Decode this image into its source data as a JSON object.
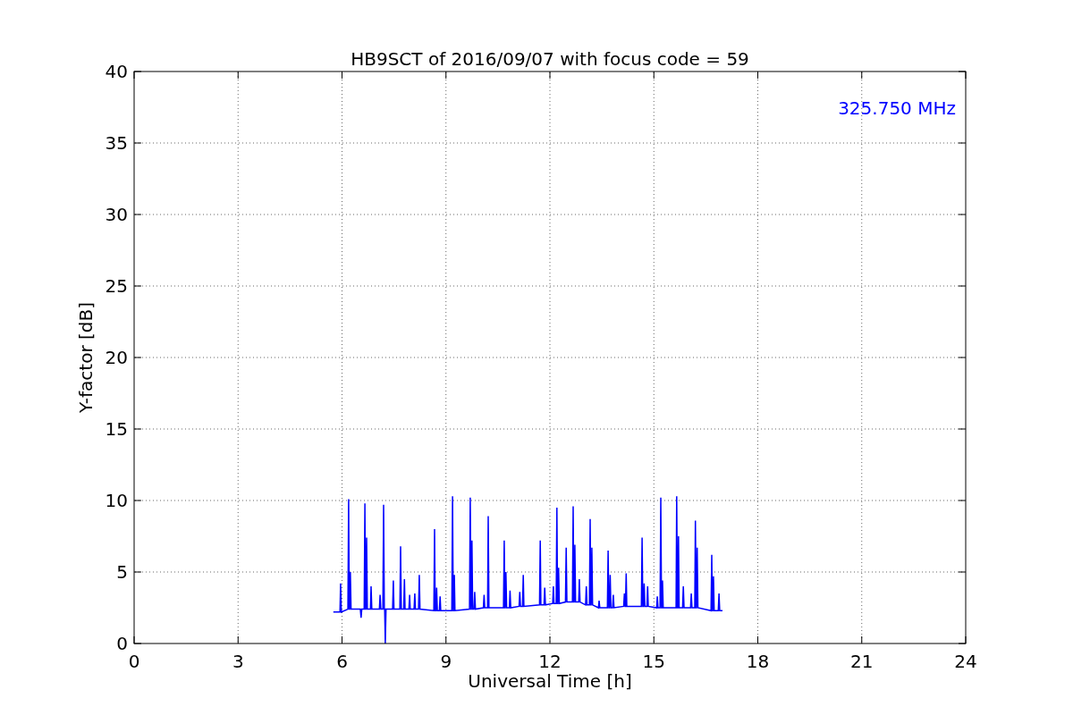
{
  "figure": {
    "chart_data": {
      "type": "line",
      "title": "HB9SCT of 2016/09/07 with focus code = 59",
      "xlabel": "Universal Time [h]",
      "ylabel": "Y-factor [dB]",
      "xlim": [
        0,
        24
      ],
      "ylim": [
        0,
        40
      ],
      "xticks": [
        0,
        3,
        6,
        9,
        12,
        15,
        18,
        21,
        24
      ],
      "yticks": [
        0,
        5,
        10,
        15,
        20,
        25,
        30,
        35,
        40
      ],
      "grid": true,
      "annotations": [
        "325.750 MHz"
      ],
      "series": [
        {
          "color": "#0000ff",
          "x": [
            5.75,
            5.94,
            5.96,
            5.98,
            6.17,
            6.19,
            6.21,
            6.22,
            6.24,
            6.26,
            6.53,
            6.55,
            6.57,
            6.64,
            6.66,
            6.68,
            6.69,
            6.71,
            6.73,
            6.82,
            6.84,
            6.86,
            7.08,
            7.1,
            7.12,
            7.18,
            7.2,
            7.22,
            7.23,
            7.25,
            7.27,
            7.46,
            7.48,
            7.5,
            7.67,
            7.69,
            7.71,
            7.78,
            7.8,
            7.82,
            7.93,
            7.95,
            7.97,
            8.08,
            8.1,
            8.12,
            8.21,
            8.23,
            8.25,
            8.65,
            8.67,
            8.69,
            8.71,
            8.73,
            8.75,
            8.81,
            8.83,
            8.85,
            9.17,
            9.19,
            9.21,
            9.22,
            9.24,
            9.26,
            9.68,
            9.7,
            9.72,
            9.73,
            9.75,
            9.77,
            9.81,
            9.83,
            9.85,
            10.08,
            10.1,
            10.12,
            10.2,
            10.22,
            10.24,
            10.66,
            10.68,
            10.7,
            10.71,
            10.73,
            10.75,
            10.83,
            10.85,
            10.87,
            11.11,
            11.13,
            11.15,
            11.21,
            11.23,
            11.25,
            11.7,
            11.72,
            11.74,
            11.83,
            11.85,
            11.87,
            12.08,
            12.1,
            12.12,
            12.18,
            12.2,
            12.22,
            12.23,
            12.25,
            12.27,
            12.45,
            12.47,
            12.49,
            12.65,
            12.67,
            12.69,
            12.7,
            12.72,
            12.74,
            12.83,
            12.85,
            12.87,
            13.03,
            13.05,
            13.07,
            13.14,
            13.16,
            13.18,
            13.19,
            13.21,
            13.23,
            13.4,
            13.42,
            13.44,
            13.66,
            13.68,
            13.7,
            13.72,
            13.74,
            13.76,
            13.81,
            13.83,
            13.85,
            14.13,
            14.15,
            14.17,
            14.18,
            14.2,
            14.22,
            14.64,
            14.66,
            14.68,
            14.7,
            14.72,
            14.74,
            14.8,
            14.82,
            14.84,
            15.08,
            15.1,
            15.12,
            15.18,
            15.2,
            15.22,
            15.23,
            15.25,
            15.27,
            15.64,
            15.66,
            15.68,
            15.69,
            15.71,
            15.73,
            15.83,
            15.85,
            15.87,
            16.06,
            16.08,
            16.1,
            16.18,
            16.2,
            16.22,
            16.23,
            16.25,
            16.27,
            16.65,
            16.67,
            16.69,
            16.7,
            16.72,
            16.74,
            16.86,
            16.88,
            16.9,
            16.98
          ],
          "values": [
            2.2,
            2.2,
            4.2,
            2.2,
            2.4,
            10.1,
            2.4,
            2.4,
            5.0,
            2.4,
            2.4,
            1.8,
            2.4,
            2.4,
            9.8,
            2.4,
            2.4,
            7.4,
            2.4,
            2.4,
            4.0,
            2.4,
            2.4,
            3.4,
            2.4,
            2.4,
            9.7,
            2.4,
            2.4,
            0,
            2.4,
            2.4,
            4.4,
            2.4,
            2.4,
            6.8,
            2.4,
            2.4,
            4.5,
            2.4,
            2.4,
            3.4,
            2.4,
            2.4,
            3.5,
            2.4,
            2.4,
            4.8,
            2.4,
            2.3,
            8.0,
            2.3,
            2.3,
            3.9,
            2.3,
            2.3,
            3.3,
            2.3,
            2.3,
            10.3,
            2.3,
            2.3,
            4.8,
            2.3,
            2.4,
            10.2,
            2.4,
            2.4,
            7.2,
            2.4,
            2.4,
            3.6,
            2.4,
            2.5,
            3.4,
            2.5,
            2.5,
            8.9,
            2.5,
            2.5,
            7.2,
            2.5,
            2.5,
            5.0,
            2.5,
            2.5,
            3.7,
            2.5,
            2.6,
            3.6,
            2.6,
            2.6,
            4.8,
            2.6,
            2.7,
            7.2,
            2.7,
            2.7,
            3.9,
            2.7,
            2.8,
            4.0,
            2.8,
            2.8,
            9.5,
            2.8,
            2.8,
            5.3,
            2.8,
            2.9,
            6.7,
            2.9,
            2.9,
            9.6,
            2.9,
            2.9,
            6.9,
            2.9,
            2.9,
            4.5,
            2.9,
            2.7,
            4.0,
            2.7,
            2.7,
            8.7,
            2.7,
            2.7,
            6.7,
            2.7,
            2.5,
            3.0,
            2.5,
            2.5,
            6.5,
            2.5,
            2.5,
            4.8,
            2.5,
            2.5,
            3.4,
            2.5,
            2.6,
            3.5,
            2.6,
            2.6,
            4.9,
            2.6,
            2.6,
            7.4,
            2.6,
            2.6,
            4.2,
            2.6,
            2.6,
            4.0,
            2.6,
            2.5,
            3.3,
            2.5,
            2.5,
            10.2,
            2.5,
            2.5,
            4.4,
            2.5,
            2.5,
            10.3,
            2.5,
            2.5,
            7.5,
            2.5,
            2.5,
            4.0,
            2.5,
            2.5,
            3.5,
            2.5,
            2.5,
            8.6,
            2.5,
            2.5,
            6.7,
            2.5,
            2.3,
            6.2,
            2.3,
            2.3,
            4.7,
            2.3,
            2.3,
            3.5,
            2.3,
            2.3
          ]
        }
      ]
    }
  }
}
